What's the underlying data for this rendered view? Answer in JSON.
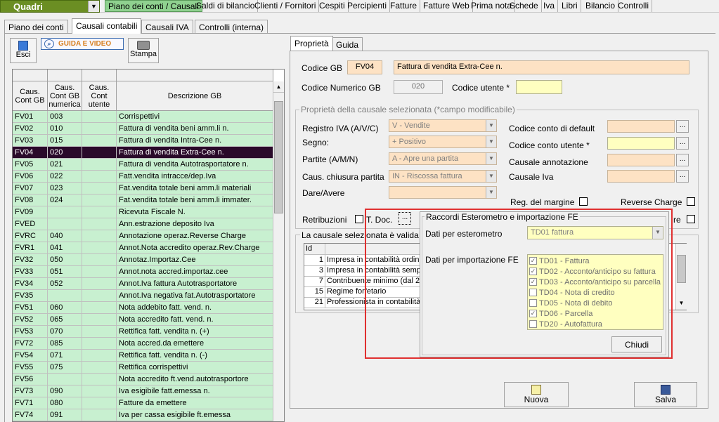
{
  "topmenu": {
    "quadri": "Quadri",
    "items": [
      "Piano dei conti / Causali",
      "Saldi di bilancio",
      "Clienti / Fornitori",
      "Cespiti",
      "Percipienti",
      "Fatture",
      "Fatture Web",
      "Prima nota",
      "Schede",
      "Iva",
      "Libri",
      "Bilancio",
      "Controlli"
    ]
  },
  "tabs": [
    "Piano dei conti",
    "Causali contabili",
    "Causali IVA",
    "Controlli (interna)"
  ],
  "toolbar": {
    "esci": "Esci",
    "guida": "GUIDA E VIDEO",
    "stampa": "Stampa"
  },
  "grid": {
    "headers": [
      "Caus. Cont GB",
      "Caus. Cont GB numerica",
      "Caus. Cont utente",
      "Descrizione GB"
    ],
    "rows": [
      [
        "FV01",
        "003",
        "",
        "Corrispettivi"
      ],
      [
        "FV02",
        "010",
        "",
        "Fattura di vendita beni amm.li n."
      ],
      [
        "FV03",
        "015",
        "",
        "Fattura di vendita Intra-Cee n."
      ],
      [
        "FV04",
        "020",
        "",
        "Fattura di vendita Extra-Cee n."
      ],
      [
        "FV05",
        "021",
        "",
        "Fattura di vendita Autotrasportatore n."
      ],
      [
        "FV06",
        "022",
        "",
        "Fatt.vendita intracce/dep.Iva"
      ],
      [
        "FV07",
        "023",
        "",
        "Fat.vendita totale beni amm.li materiali"
      ],
      [
        "FV08",
        "024",
        "",
        "Fat.vendita totale beni amm.li immater."
      ],
      [
        "FV09",
        "",
        "",
        "Ricevuta Fiscale N."
      ],
      [
        "FVED",
        "",
        "",
        "Ann.estrazione deposito Iva"
      ],
      [
        "FVRC",
        "040",
        "",
        "Annotazione operaz.Reverse Charge"
      ],
      [
        "FVR1",
        "041",
        "",
        "Annot.Nota accredito operaz.Rev.Charge"
      ],
      [
        "FV32",
        "050",
        "",
        "Annotaz.Importaz.Cee"
      ],
      [
        "FV33",
        "051",
        "",
        "Annot.nota accred.importaz.cee"
      ],
      [
        "FV34",
        "052",
        "",
        "Annot.Iva fattura Autotrasportatore"
      ],
      [
        "FV35",
        "",
        "",
        "Annot.Iva negativa fat.Autotrasportatore"
      ],
      [
        "FV51",
        "060",
        "",
        "Nota addebito fatt. vend. n."
      ],
      [
        "FV52",
        "065",
        "",
        "Nota accredito fatt. vend. n."
      ],
      [
        "FV53",
        "070",
        "",
        "Rettifica fatt. vendita n. (+)"
      ],
      [
        "FV72",
        "085",
        "",
        "Nota accred.da emettere"
      ],
      [
        "FV54",
        "071",
        "",
        "Rettifica fatt. vendita n. (-)"
      ],
      [
        "FV55",
        "075",
        "",
        "Rettifica corrispettivi"
      ],
      [
        "FV56",
        "",
        "",
        "Nota accredito ft.vend.autotrasportore"
      ],
      [
        "FV73",
        "090",
        "",
        "Iva esigibile fatt.emessa n."
      ],
      [
        "FV71",
        "080",
        "",
        "Fatture da emettere"
      ],
      [
        "FV74",
        "091",
        "",
        "Iva per cassa esigibile ft.emessa"
      ]
    ],
    "selected_index": 3
  },
  "right_tabs": [
    "Proprietà",
    "Guida"
  ],
  "codice": {
    "codice_gb_label": "Codice GB",
    "codice_gb": "FV04",
    "descrizione": "Fattura di vendita Extra-Cee n.",
    "numerico_label": "Codice Numerico GB",
    "numerico": "020",
    "utente_label": "Codice utente *",
    "utente": ""
  },
  "props": {
    "title": "Proprietà della causale selezionata (*campo modificabile)",
    "registro_label": "Registro IVA (A/V/C)",
    "registro": "V - Vendite",
    "segno_label": "Segno:",
    "segno": "+ Positivo",
    "partite_label": "Partite (A/M/N)",
    "partite": "A - Apre una partita",
    "chiusura_label": "Caus. chiusura partita",
    "chiusura": "IN - Riscossa fattura",
    "dare_label": "Dare/Avere",
    "dare": "",
    "default_label": "Codice conto di default",
    "utente_label": "Codice conto utente *",
    "annotazione_label": "Causale annotazione",
    "iva_label": "Causale Iva",
    "margine_label": "Reg. del margine",
    "reverse_label": "Reverse Charge",
    "retribuzioni_label": "Retribuzioni",
    "tdoc_label": "T. Doc.",
    "dots": "...",
    "cut_label": "re"
  },
  "validity": {
    "title": "La causale selezionata è valida",
    "id_header": "Id",
    "rows": [
      [
        "1",
        "Impresa  in contabilità ordina"
      ],
      [
        "3",
        "Impresa  in contabilità sempl"
      ],
      [
        "7",
        "Contribuente minimo (dal 201"
      ],
      [
        "15",
        "Regime forfetario"
      ],
      [
        "21",
        "Professionista in contabilità o"
      ]
    ]
  },
  "popup": {
    "title": "Raccordi Esterometro e importazione FE",
    "estero_label": "Dati per esterometro",
    "estero_value": "TD01 fattura",
    "fe_label": "Dati per importazione FE",
    "fe_items": [
      {
        "label": "TD01 - Fattura",
        "checked": true
      },
      {
        "label": "TD02 - Acconto/anticipo su fattura",
        "checked": true
      },
      {
        "label": "TD03 - Acconto/anticipo su parcella",
        "checked": true
      },
      {
        "label": "TD04 - Nota di credito",
        "checked": false
      },
      {
        "label": "TD05 - Nota di debito",
        "checked": false
      },
      {
        "label": "TD06 - Parcella",
        "checked": true
      },
      {
        "label": "TD20 - Autofattura",
        "checked": false
      }
    ],
    "chiudi": "Chiudi"
  },
  "buttons": {
    "nuova": "Nuova",
    "salva": "Salva"
  },
  "colors": {
    "grid_row": "#c8f0d0",
    "selected_row": "#2a0a2a",
    "highlight": "#e03030",
    "quadri": "#6b8e23"
  }
}
